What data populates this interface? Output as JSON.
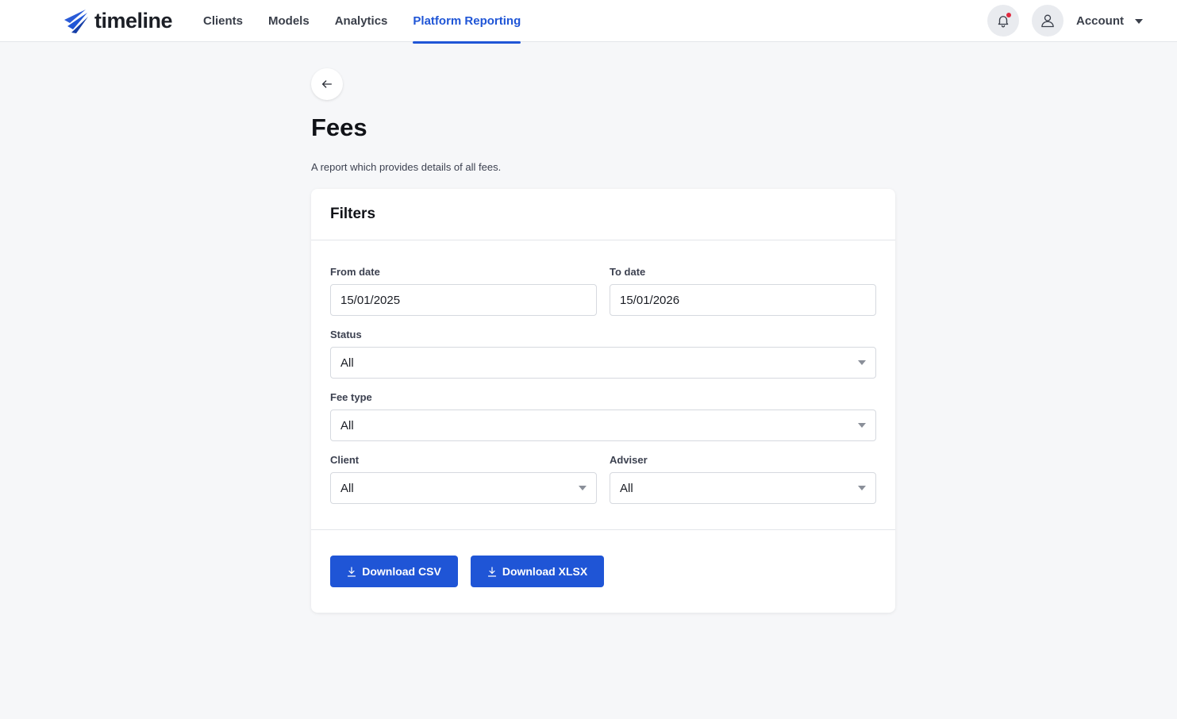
{
  "app": {
    "logo_text": "timeline"
  },
  "nav": {
    "items": [
      {
        "label": "Clients",
        "active": false
      },
      {
        "label": "Models",
        "active": false
      },
      {
        "label": "Analytics",
        "active": false
      },
      {
        "label": "Platform Reporting",
        "active": true
      }
    ]
  },
  "header": {
    "account_label": "Account",
    "icons": [
      "bell-icon",
      "user-icon",
      "caret-down-icon"
    ]
  },
  "page": {
    "title": "Fees",
    "description": "A report which provides details of all fees."
  },
  "filters": {
    "title": "Filters",
    "from_date": {
      "label": "From date",
      "value": "15/01/2025"
    },
    "to_date": {
      "label": "To date",
      "value": "15/01/2026"
    },
    "status": {
      "label": "Status",
      "value": "All"
    },
    "fee_type": {
      "label": "Fee type",
      "value": "All"
    },
    "client": {
      "label": "Client",
      "value": "All"
    },
    "adviser": {
      "label": "Adviser",
      "value": "All"
    }
  },
  "actions": {
    "download_csv": "Download CSV",
    "download_xlsx": "Download XLSX"
  },
  "colors": {
    "accent": "#1f55d6",
    "background": "#f6f7f9",
    "notification": "#e0293f"
  }
}
